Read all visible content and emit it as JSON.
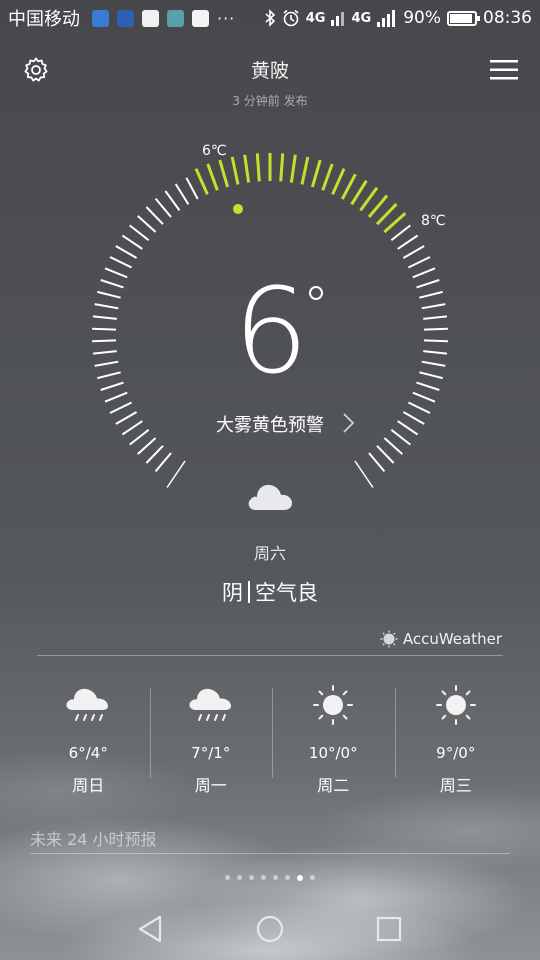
{
  "status_bar": {
    "carrier": "中国移动",
    "overflow": "···",
    "network_1": "4G",
    "network_2": "4G",
    "battery_percent": "90%",
    "battery_level": 0.9,
    "time": "08:36"
  },
  "header": {
    "city": "黄陂",
    "published": "3 分钟前 发布"
  },
  "dial": {
    "current_temp": "6",
    "low_label": "6℃",
    "high_label": "8℃",
    "alert": "大雾黄色预警",
    "accent_color": "#c7e02c"
  },
  "today": {
    "day": "周六",
    "weather": "阴",
    "air": "空气良"
  },
  "provider": "AccuWeather",
  "forecast": [
    {
      "icon": "rain-cloud-icon",
      "temp": "6°/4°",
      "day": "周日"
    },
    {
      "icon": "rain-cloud-icon",
      "temp": "7°/1°",
      "day": "周一"
    },
    {
      "icon": "sun-icon",
      "temp": "10°/0°",
      "day": "周二"
    },
    {
      "icon": "sun-icon",
      "temp": "9°/0°",
      "day": "周三"
    }
  ],
  "hourly_title": "未来 24 小时预报",
  "pager": {
    "pages": 8,
    "active_index": 6
  }
}
